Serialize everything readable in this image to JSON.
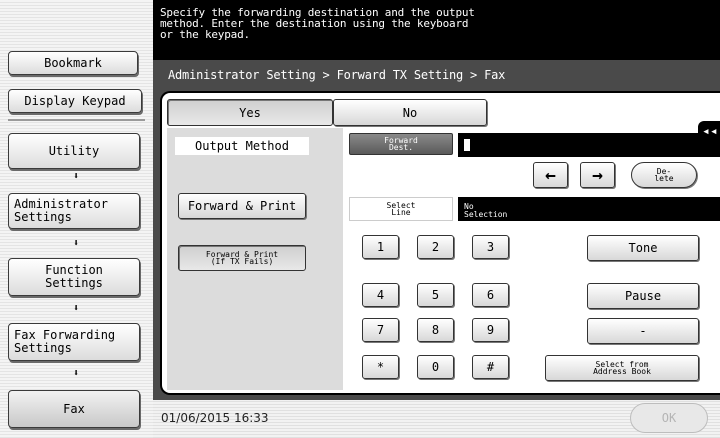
{
  "sidebar": {
    "bookmark": "Bookmark",
    "display_keypad": "Display Keypad",
    "nav": [
      {
        "label": "Utility"
      },
      {
        "label": "Administrator\nSettings"
      },
      {
        "label": "Function\nSettings"
      },
      {
        "label": "Fax Forwarding\nSettings"
      },
      {
        "label": "Fax"
      }
    ],
    "arrow_glyph": "⬇"
  },
  "header": {
    "message": "Specify the forwarding destination and the output\nmethod.  Enter the destination using the keyboard\nor the keypad."
  },
  "breadcrumb": "Administrator Setting > Forward TX Setting > Fax",
  "toggle": {
    "yes": "Yes",
    "no": "No",
    "selected": "Yes"
  },
  "output": {
    "heading": "Output Method",
    "forward_print": "Forward & Print",
    "forward_print_fail": "Forward & Print\n(If TX Fails)"
  },
  "destination": {
    "label": "Forward\nDest.",
    "value": "",
    "left_arrow": "←",
    "right_arrow": "→",
    "delete": "De-\nlete"
  },
  "select_line": {
    "label": "Select\nLine",
    "value": "No\nSelection"
  },
  "keypad": {
    "keys": [
      "1",
      "2",
      "3",
      "4",
      "5",
      "6",
      "7",
      "8",
      "9",
      "*",
      "0",
      "#"
    ],
    "tone": "Tone",
    "pause": "Pause",
    "dash": "-",
    "address_book": "Select from\nAddress Book"
  },
  "side_tab_glyph": "◂◂",
  "footer": {
    "datetime": "01/06/2015  16:33",
    "ok": "OK"
  }
}
